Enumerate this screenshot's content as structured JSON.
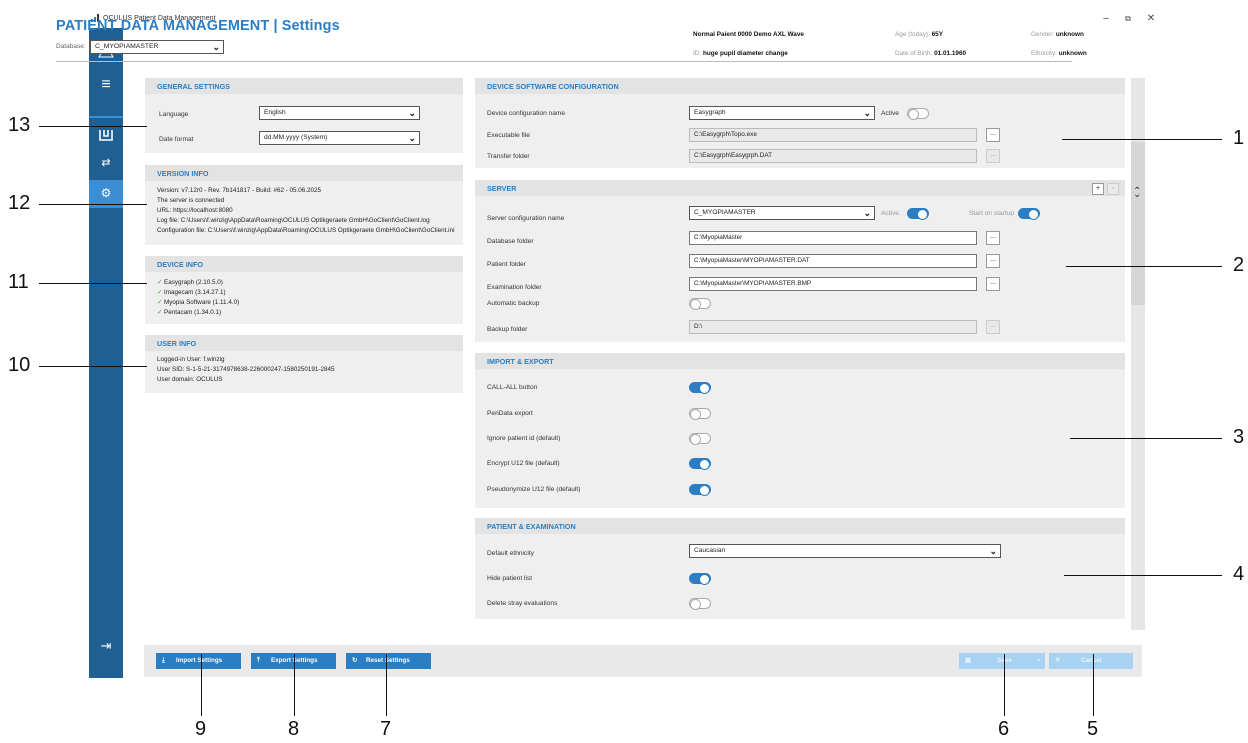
{
  "window": {
    "title": "OCULUS Patient Data Management"
  },
  "header": {
    "title": "PATIENT DATA MANAGEMENT | Settings",
    "database_label": "Database:",
    "database_value": "C_MYOPIAMASTER",
    "patient_name": "Normal Paient 0000 Demo AXL Wave",
    "id_label": "ID:",
    "id_value": "huge pupil diameter change",
    "age_label": "Age (today):",
    "age_value": "65Y",
    "dob_label": "Date of Birth:",
    "dob_value": "01.01.1960",
    "gender_label": "Gender:",
    "gender_value": "unknown",
    "ethnicity_label": "Ethnicity:",
    "ethnicity_value": "unknown"
  },
  "general": {
    "title": "GENERAL SETTINGS",
    "language_label": "Language",
    "language_value": "English",
    "date_label": "Date format",
    "date_value": "dd.MM.yyyy (System)"
  },
  "version": {
    "title": "VERSION INFO",
    "lines": [
      "Version: v7.12r0 - Rev. 7b141817 - Build: #62 - 05.06.2025",
      "The server is connected",
      "URL: https://localhost:8080",
      "Log file: C:\\Users\\f.winzig\\AppData\\Roaming\\OCULUS Optikgeraete GmbH\\GoClient\\GoClient.log",
      "Configuration file: C:\\Users\\f.winzig\\AppData\\Roaming\\OCULUS Optikgeraete GmbH\\GoClient\\GoClient.ini"
    ]
  },
  "device_info": {
    "title": "DEVICE INFO",
    "items": [
      "Easygraph (2.10.5.0)",
      "Imagecam (3.14.27.1)",
      "Myopia Software (1.11.4.0)",
      "Pentacam (1.34.0.1)"
    ]
  },
  "user_info": {
    "title": "USER INFO",
    "lines": [
      "Logged-in User: f.winzig",
      "User SID: S-1-5-21-3174978638-226000247-1580250191-2845",
      "User domain: OCULUS"
    ]
  },
  "device_software": {
    "title": "DEVICE SOFTWARE CONFIGURATION",
    "config_label": "Device configuration name",
    "config_value": "Easygraph",
    "active_label": "Active",
    "active_on": false,
    "exec_label": "Executable file",
    "exec_value": "C:\\Easygrph\\Topo.exe",
    "transfer_label": "Transfer folder",
    "transfer_value": "C:\\Easygrph\\Easygrph.DAT",
    "browse": "..."
  },
  "server": {
    "title": "SERVER",
    "plus": "+",
    "minus": "-",
    "config_label": "Server configuration name",
    "config_value": "C_MYOPIAMASTER",
    "active_label": "Active",
    "active_on": true,
    "startup_label": "Start on startup",
    "startup_on": true,
    "db_label": "Database folder",
    "db_value": "C:\\MyopiaMaster",
    "patient_label": "Patient folder",
    "patient_value": "C:\\MyopiaMaster\\MYOPIAMASTER.DAT",
    "exam_label": "Examination folder",
    "exam_value": "C:\\MyopiaMaster\\MYOPIAMASTER.BMP",
    "auto_label": "Automatic backup",
    "auto_on": false,
    "backup_label": "Backup folder",
    "backup_value": "D:\\"
  },
  "import_export": {
    "title": "IMPORT & EXPORT",
    "items": [
      {
        "label": "CALL-ALL button",
        "on": true
      },
      {
        "label": "PeriData export",
        "on": false
      },
      {
        "label": "Ignore patient id (default)",
        "on": false
      },
      {
        "label": "Encrypt U12 file (default)",
        "on": true
      },
      {
        "label": "Pseudonymize U12 file (default)",
        "on": true
      }
    ]
  },
  "patient_exam": {
    "title": "PATIENT & EXAMINATION",
    "ethnicity_label": "Default ethnicity",
    "ethnicity_value": "Caucasian",
    "hide_label": "Hide patient list",
    "hide_on": true,
    "delete_label": "Delete stray evaluations",
    "delete_on": false
  },
  "footer": {
    "import": "Import Settings",
    "export": "Export Settings",
    "reset": "Reset Settings",
    "save": "Save",
    "cancel": "Cancel"
  },
  "callouts": [
    "1",
    "2",
    "3",
    "4",
    "5",
    "6",
    "7",
    "8",
    "9",
    "10",
    "11",
    "12",
    "13"
  ]
}
